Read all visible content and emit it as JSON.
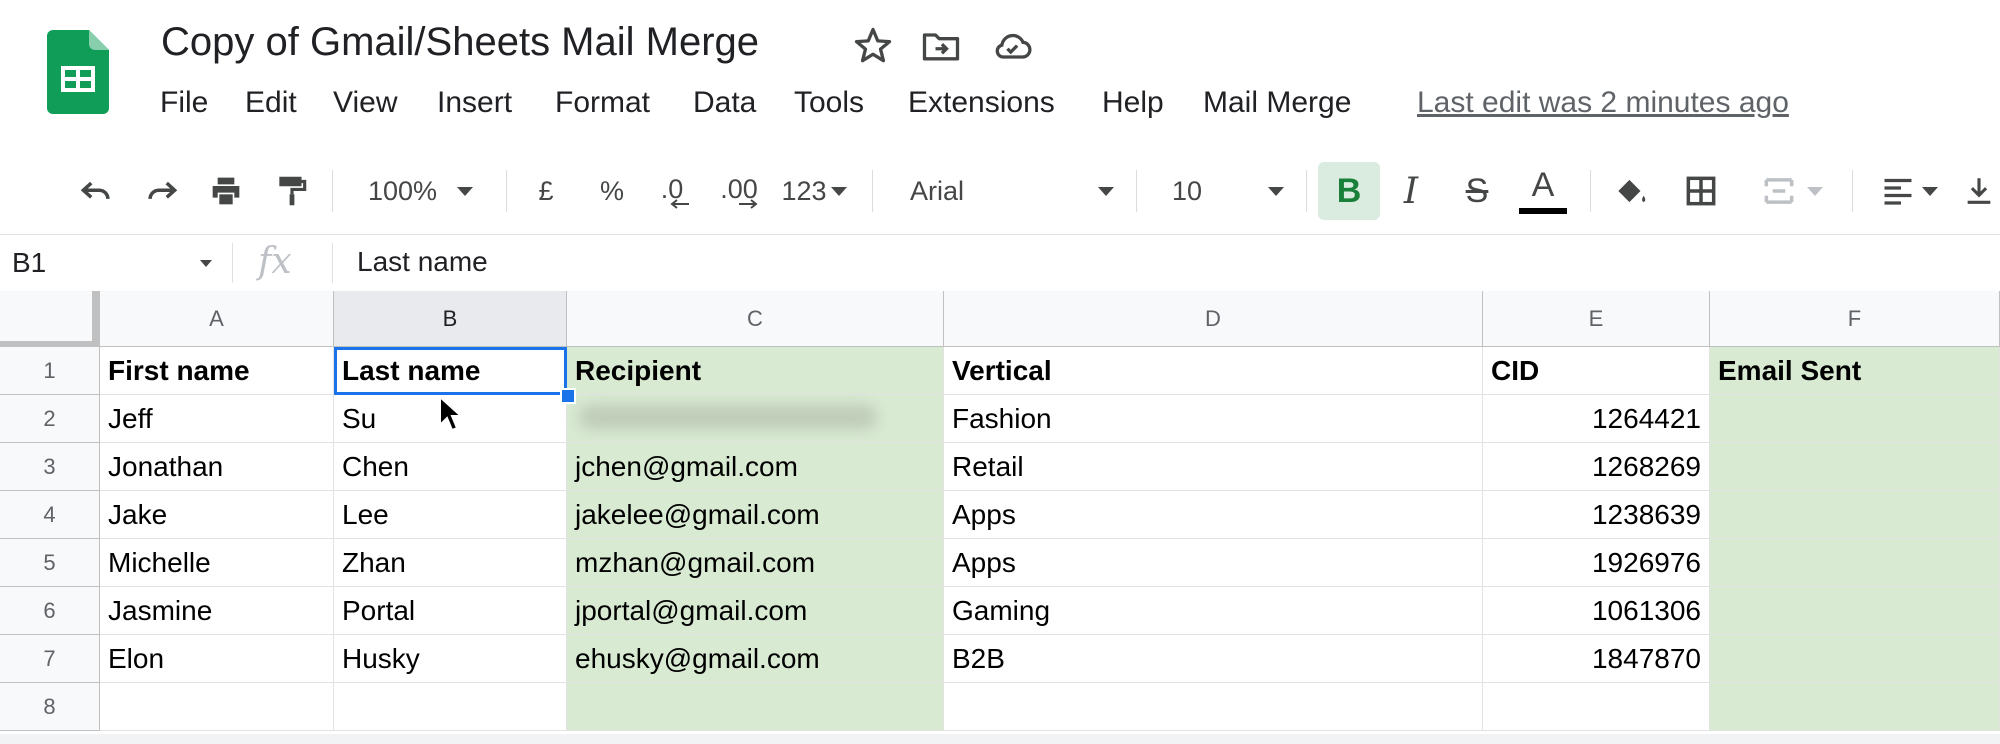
{
  "app": {
    "doc_title": "Copy of Gmail/Sheets Mail Merge",
    "title_icons": [
      "star-icon",
      "move-to-folder-icon",
      "cloud-saved-icon"
    ],
    "menu": [
      "File",
      "Edit",
      "View",
      "Insert",
      "Format",
      "Data",
      "Tools",
      "Extensions",
      "Help",
      "Mail Merge"
    ],
    "last_edit": "Last edit was 2 minutes ago",
    "brand_color": "#0f9d58"
  },
  "toolbar": {
    "zoom": "100%",
    "currency": "£",
    "percent": "%",
    "decrease_decimals": ".0",
    "increase_decimals": ".00",
    "more_formats": "123",
    "font": "Arial",
    "font_size": "10",
    "bold": "B",
    "italic": "I",
    "strike": "S",
    "text_color": "A",
    "icons": [
      "undo-icon",
      "redo-icon",
      "print-icon",
      "paint-format-icon",
      "fill-color-icon",
      "borders-icon",
      "merge-cells-icon",
      "align-left-icon",
      "vertical-align-icon"
    ],
    "bold_active": true,
    "text_color_value": "#000000"
  },
  "formula_bar": {
    "name_box": "B1",
    "fx": "fx",
    "value": "Last name"
  },
  "sheet": {
    "columns": [
      "A",
      "B",
      "C",
      "D",
      "E",
      "F"
    ],
    "selected_column": "B",
    "selected_cell": "B1",
    "rows": [
      "1",
      "2",
      "3",
      "4",
      "5",
      "6",
      "7",
      "8"
    ],
    "green_fill": "#d9ead3",
    "cells": [
      [
        "First name",
        "Last name",
        "Recipient",
        "Vertical",
        "CID",
        "Email Sent"
      ],
      [
        "Jeff",
        "Su",
        "",
        "Fashion",
        "1264421",
        ""
      ],
      [
        "Jonathan",
        "Chen",
        "jchen@gmail.com",
        "Retail",
        "1268269",
        ""
      ],
      [
        "Jake",
        "Lee",
        "jakelee@gmail.com",
        "Apps",
        "1238639",
        ""
      ],
      [
        "Michelle",
        "Zhan",
        "mzhan@gmail.com",
        "Apps",
        "1926976",
        ""
      ],
      [
        "Jasmine",
        "Portal",
        "jportal@gmail.com",
        "Gaming",
        "1061306",
        ""
      ],
      [
        "Elon",
        "Husky",
        "ehusky@gmail.com",
        "B2B",
        "1847870",
        ""
      ],
      [
        "",
        "",
        "",
        "",
        "",
        ""
      ]
    ]
  }
}
